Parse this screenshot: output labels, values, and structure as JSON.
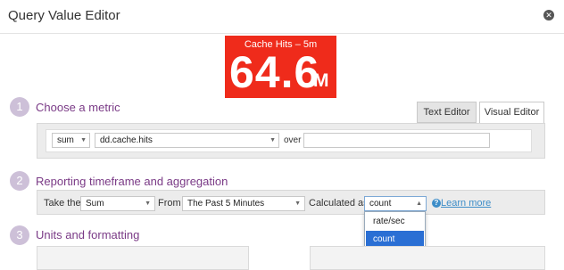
{
  "dialog": {
    "title": "Query Value Editor",
    "close_glyph": "✕"
  },
  "preview": {
    "label": "Cache Hits – 5m",
    "value": "64.6",
    "unit": "M",
    "background": "#ef2b1b"
  },
  "steps": [
    {
      "number": "1",
      "title": "Choose a metric"
    },
    {
      "number": "2",
      "title": "Reporting timeframe and aggregation"
    },
    {
      "number": "3",
      "title": "Units and formatting"
    }
  ],
  "editor_tabs": {
    "text_editor": "Text Editor",
    "visual_editor": "Visual Editor"
  },
  "metric": {
    "aggregator": "sum",
    "name": "dd.cache.hits",
    "over_label": "over",
    "over_value": ""
  },
  "aggregation": {
    "take_the_label": "Take the",
    "take_the_value": "Sum",
    "from_label": "From",
    "from_value": "The Past 5 Minutes",
    "calculated_as_label": "Calculated as",
    "calculated_as_value": "count",
    "learn_more": "Learn more",
    "options": [
      "rate/sec",
      "count"
    ],
    "selected_option": "count"
  },
  "colors": {
    "accent": "#7a3a86",
    "link": "#3d8dc8",
    "selection": "#2a6fd4",
    "step_circle": "#cdc0d8"
  }
}
